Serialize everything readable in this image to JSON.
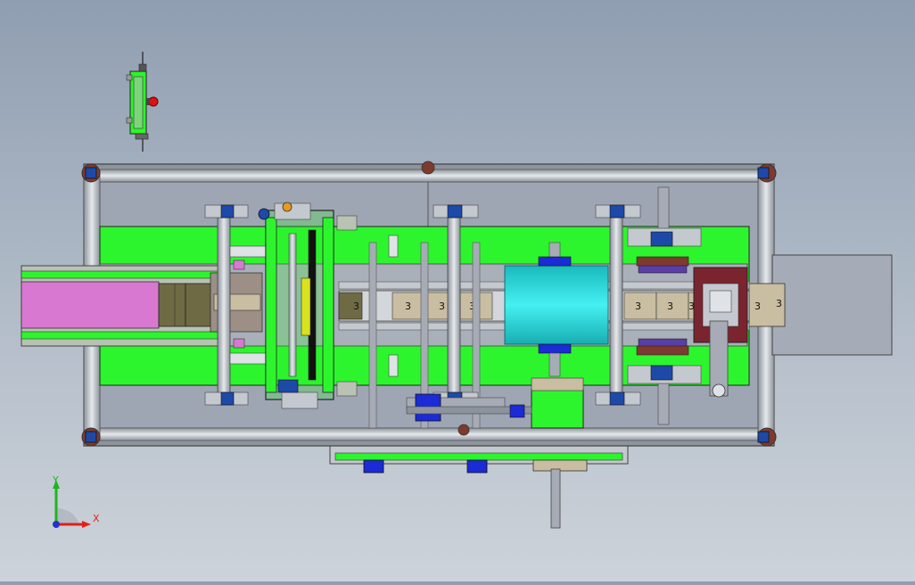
{
  "viewport": {
    "background_top": "#8f9eb1",
    "background_bottom": "#cdd3da"
  },
  "colors": {
    "frame": "#b9bfc6",
    "frame_dark": "#5e6670",
    "bed": "#9fa6b3",
    "green": "#2df52d",
    "magenta": "#d978d1",
    "cyan": "#26d3d6",
    "blue": "#1b2bd6",
    "corner": "#7d3a2e",
    "maroon": "#7a2430",
    "olive": "#6e6a44",
    "part": "#c9bda2"
  },
  "station_labels": {
    "mark": "3"
  },
  "triad": {
    "y_label": "Y",
    "x_label": "X",
    "y_color": "#1fb51f",
    "x_color": "#e0201a",
    "z_color": "#2233cc"
  }
}
